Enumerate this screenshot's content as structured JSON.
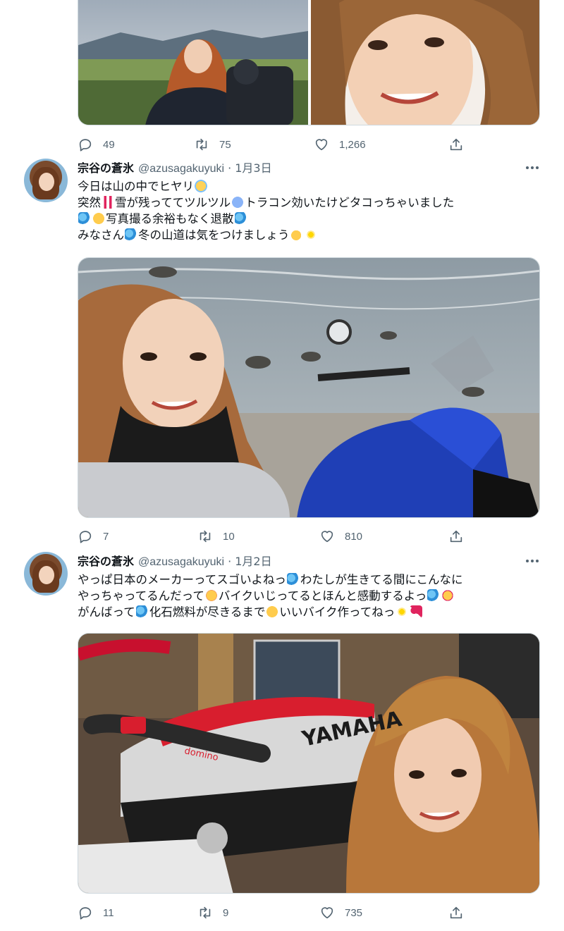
{
  "tweets": [
    {
      "id": "t0",
      "media_count": 2,
      "actions": {
        "replies": "49",
        "retweets": "75",
        "likes": "1,266"
      }
    },
    {
      "id": "t1",
      "author": {
        "name": "宗谷の蒼氷",
        "handle": "@azusagakuyuki",
        "separator": "·",
        "date": "1月3日"
      },
      "lines": [
        [
          {
            "t": "今日は山の中でヒヤリ"
          },
          {
            "e": "scream"
          }
        ],
        [
          {
            "t": "突然"
          },
          {
            "e": "bang"
          },
          {
            "t": "雪が残っててツルツル"
          },
          {
            "e": "cold"
          },
          {
            "t": "トラコン効いたけどタコっちゃいました"
          }
        ],
        [
          {
            "e": "sweat"
          },
          {
            "e": "grin"
          },
          {
            "t": "写真撮る余裕もなく退散"
          },
          {
            "e": "sweat"
          }
        ],
        [
          {
            "t": "みなさん"
          },
          {
            "e": "sweat"
          },
          {
            "t": "冬の山道は気をつけましょう"
          },
          {
            "e": "thumb"
          },
          {
            "e": "spark"
          }
        ]
      ],
      "actions": {
        "replies": "7",
        "retweets": "10",
        "likes": "810"
      }
    },
    {
      "id": "t2",
      "author": {
        "name": "宗谷の蒼氷",
        "handle": "@azusagakuyuki",
        "separator": "·",
        "date": "1月2日"
      },
      "lines": [
        [
          {
            "t": "やっぱ日本のメーカーってスゴいよねっ"
          },
          {
            "e": "sweat"
          },
          {
            "t": "わたしが生きてる間にこんなに"
          }
        ],
        [
          {
            "t": "やっちゃってるんだって"
          },
          {
            "e": "smile"
          },
          {
            "t": "バイクいじってるとほんと感動するよっ"
          },
          {
            "e": "sweat"
          },
          {
            "e": "love"
          }
        ],
        [
          {
            "t": "がんばって"
          },
          {
            "e": "sweat"
          },
          {
            "t": "化石燃料が尽きるまで"
          },
          {
            "e": "grin"
          },
          {
            "t": "いいバイク作ってねっ"
          },
          {
            "e": "spark"
          },
          {
            "e": "heart"
          }
        ]
      ],
      "actions": {
        "replies": "11",
        "retweets": "9",
        "likes": "735"
      }
    }
  ],
  "icons": {
    "reply": "reply-icon",
    "retweet": "retweet-icon",
    "like": "heart-icon",
    "share": "share-icon",
    "more": "more-icon"
  },
  "photos": {
    "t0_left": "woman with motorcycle on mountain road",
    "t0_right": "close-up selfie smiling",
    "t1": "selfie with blue Yamaha motorcycle by rocky shore",
    "t2": "selfie with red and white YAMAHA motorcycle in garage"
  },
  "photo_text": {
    "t2_fairing": "YAMAHA",
    "t2_grip": "domino"
  },
  "colors": {
    "text": "#0f1419",
    "muted": "#536471",
    "border": "#cfd9de"
  }
}
